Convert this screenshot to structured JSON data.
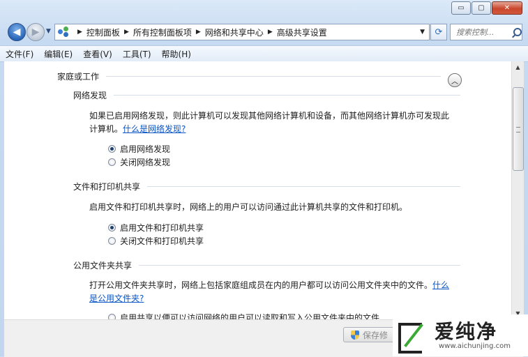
{
  "window": {
    "caption_buttons": {
      "minimize": "▭",
      "maximize": "▢",
      "close": "✕"
    }
  },
  "address_bar": {
    "crumbs": [
      "控制面板",
      "所有控制面板项",
      "网络和共享中心",
      "高级共享设置"
    ],
    "search_placeholder": "搜索控制...",
    "icons": [
      "back-arrow-icon",
      "forward-arrow-icon",
      "network-icon",
      "refresh-icon",
      "search-icon"
    ]
  },
  "menu": {
    "items": [
      "文件(F)",
      "编辑(E)",
      "查看(V)",
      "工具(T)",
      "帮助(H)"
    ]
  },
  "profile": {
    "title": "家庭或工作"
  },
  "network_discovery": {
    "heading": "网络发现",
    "description_line1": "如果已启用网络发现，则此计算机可以发现其他网络计算机和设备，而其他网络计算机亦可发现此",
    "description_line2": "计算机。",
    "link": "什么是网络发现?",
    "options": [
      "启用网络发现",
      "关闭网络发现"
    ],
    "selected": 0
  },
  "file_printer_sharing": {
    "heading": "文件和打印机共享",
    "description": "启用文件和打印机共享时，网络上的用户可以访问通过此计算机共享的文件和打印机。",
    "options": [
      "启用文件和打印机共享",
      "关闭文件和打印机共享"
    ],
    "selected": 0
  },
  "public_folder_sharing": {
    "heading": "公用文件夹共享",
    "description_line1": "打开公用文件夹共享时，网络上包括家庭组成员在内的用户都可以访问公用文件夹中的文件。",
    "link_part1": "什么",
    "link_part2": "是公用文件夹?",
    "option_partial": "启用共享以便可以访问网络的用户可以读取和写入公用文件夹中的文件"
  },
  "footer": {
    "save_label": "保存修"
  },
  "watermark": {
    "title": "爱纯净",
    "url": "www.aichunjing.com"
  },
  "colors": {
    "link": "#0a54c5",
    "frame": "#c6daf1"
  }
}
